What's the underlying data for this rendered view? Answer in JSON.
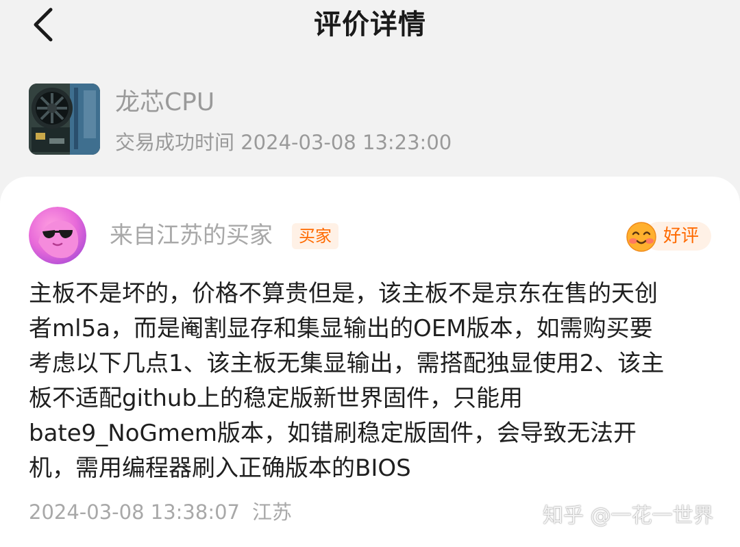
{
  "header": {
    "title": "评价详情"
  },
  "product": {
    "name": "龙芯CPU",
    "time_label": "交易成功时间",
    "time_value": "2024-03-08 13:23:00"
  },
  "review": {
    "buyer_name": "来自江苏的买家",
    "buyer_badge": "买家",
    "rating_label": "好评",
    "text_lines": [
      "主板不是坏的，价格不算贵但是，该主板不是京东在售的天创",
      "者ml5a，而是阉割显存和集显输出的OEM版本，如需购买要",
      "考虑以下几点1、该主板无集显输出，需搭配独显使用2、该主",
      "板不适配github上的稳定版新世界固件，只能用",
      "bate9_NoGmem版本，如错刷稳定版固件，会导致无法开",
      "机，需用编程器刷入正确版本的BIOS"
    ],
    "date": "2024-03-08 13:38:07",
    "region": "江苏"
  },
  "watermark": {
    "text": "知乎 @一花一世界"
  },
  "icons": {
    "back": "chevron-left-icon",
    "rating_face": "smiling-face-icon"
  },
  "colors": {
    "accent": "#ff6a00",
    "badge_bg": "#fff1e6",
    "muted_text": "#9a9a9a",
    "body_text": "#1f1f1f"
  }
}
